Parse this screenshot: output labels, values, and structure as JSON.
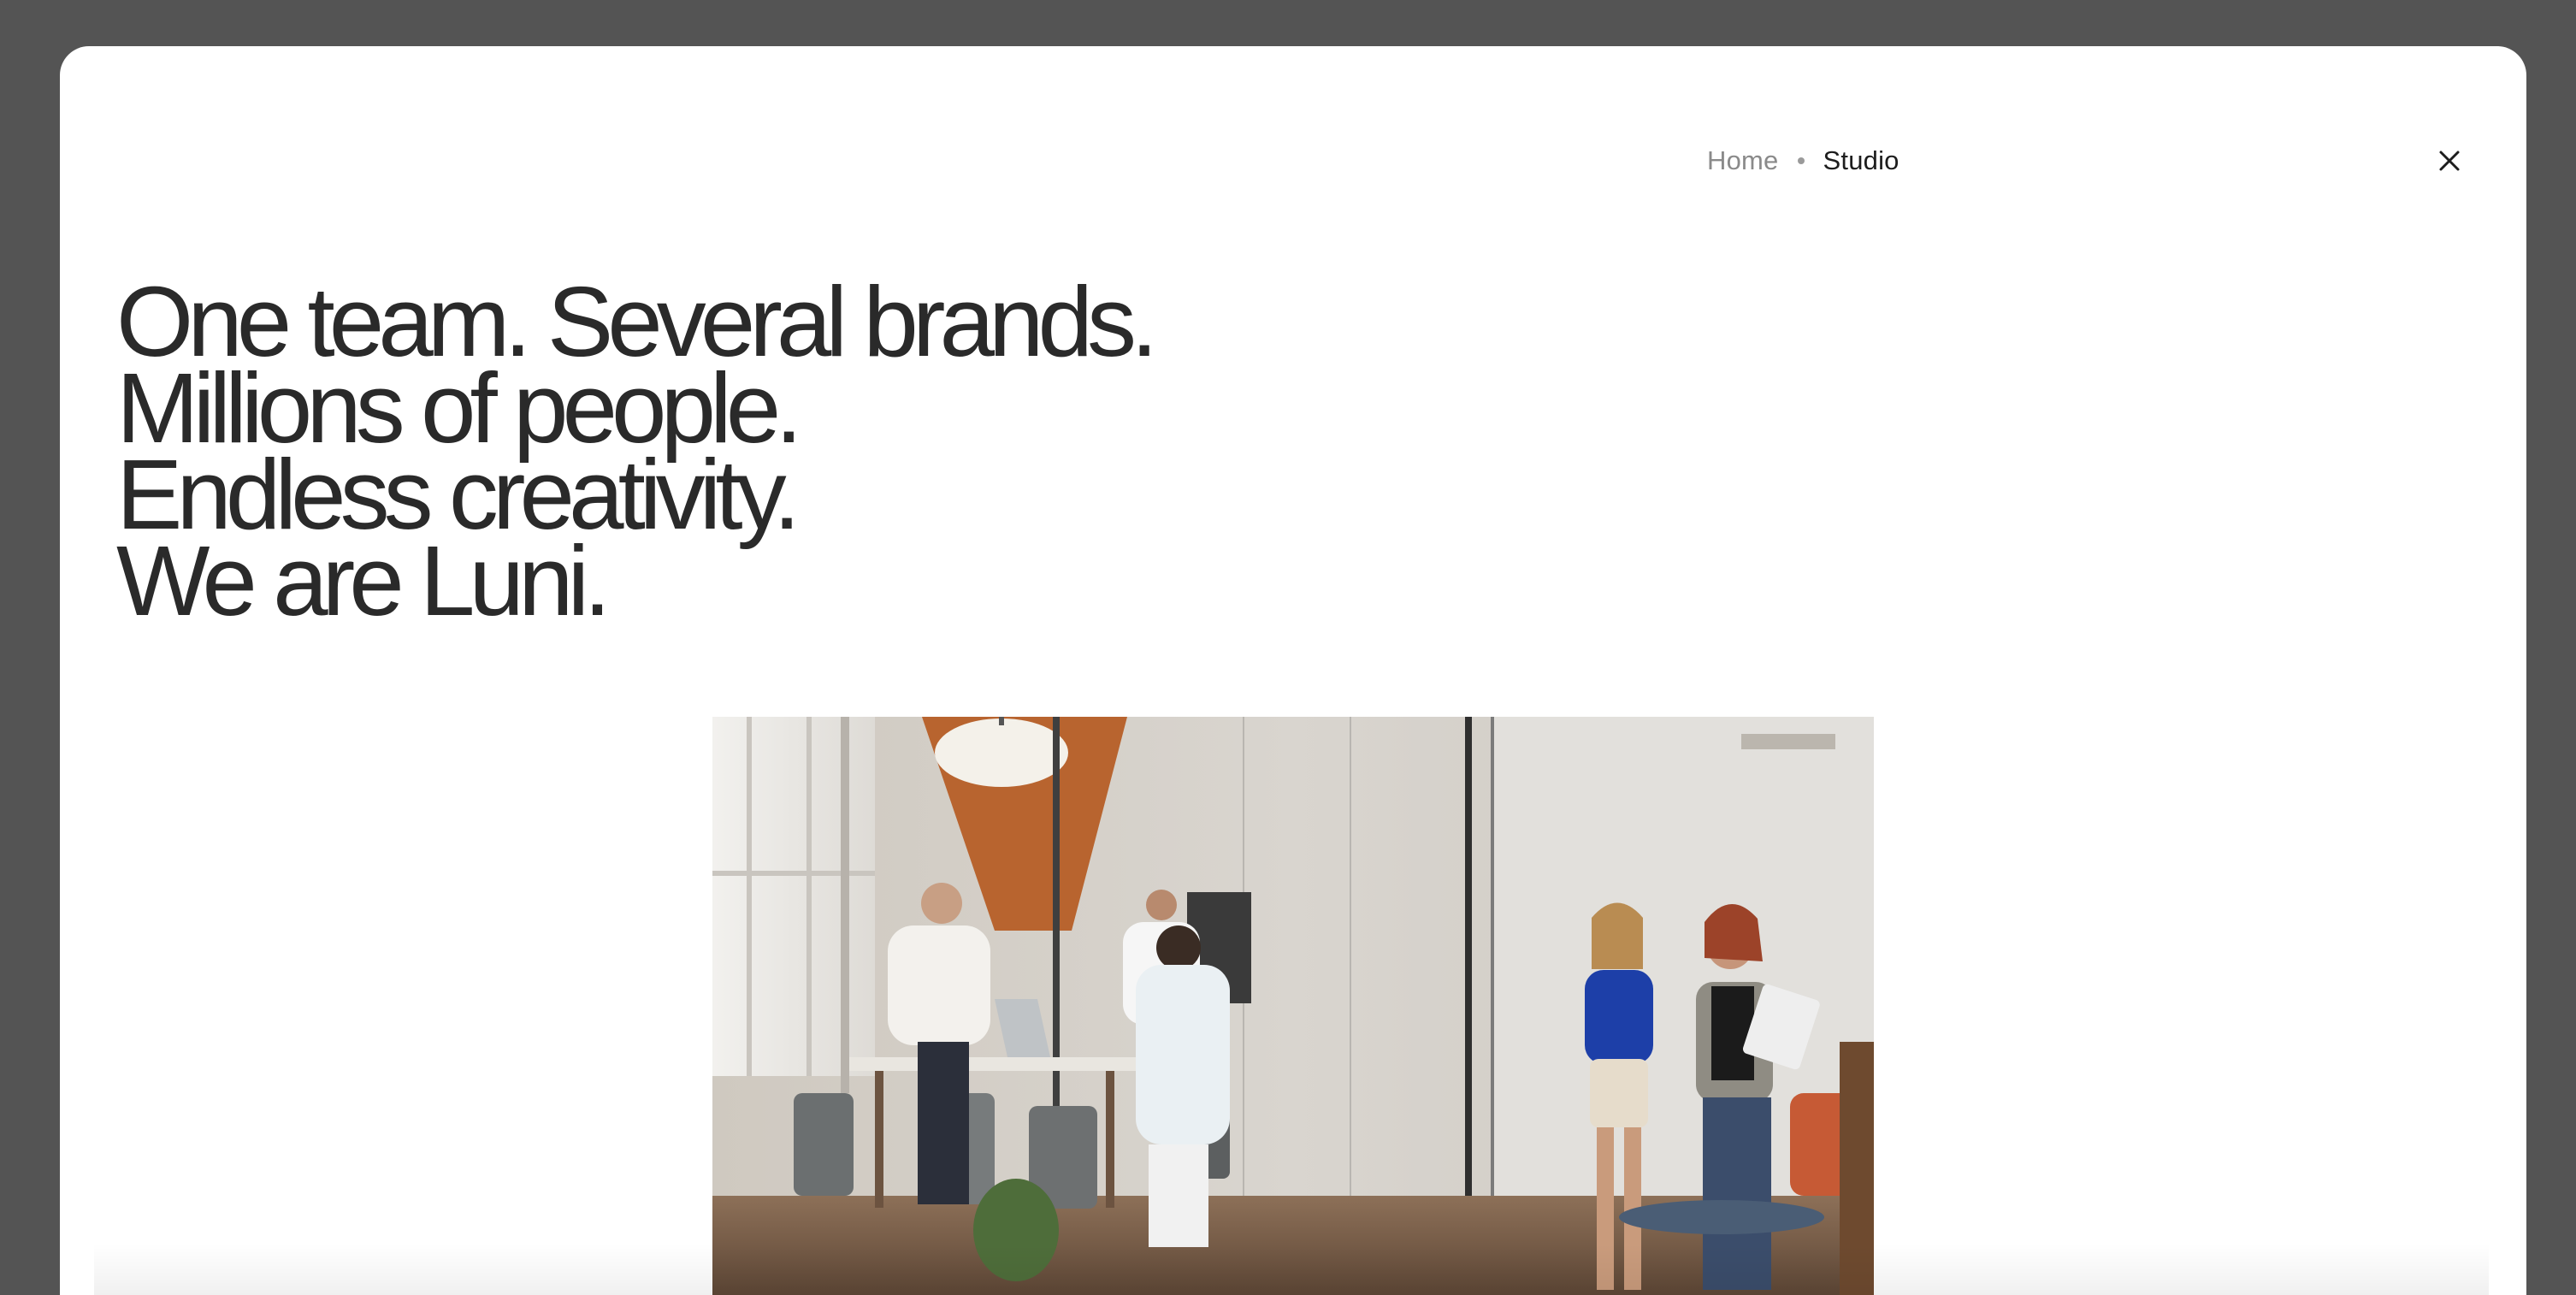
{
  "breadcrumb": {
    "home_label": "Home",
    "current_label": "Studio"
  },
  "close": {
    "icon": "close-icon"
  },
  "hero": {
    "lines": [
      "One team. Several brands.",
      "Millions of people.",
      "Endless creativity.",
      "We are Luni."
    ]
  },
  "colors": {
    "backdrop": "#545454",
    "modal": "#ffffff",
    "headline": "#2a2a2a",
    "breadcrumb_muted": "#8a8a8a",
    "breadcrumb_active": "#1d1d1d"
  }
}
